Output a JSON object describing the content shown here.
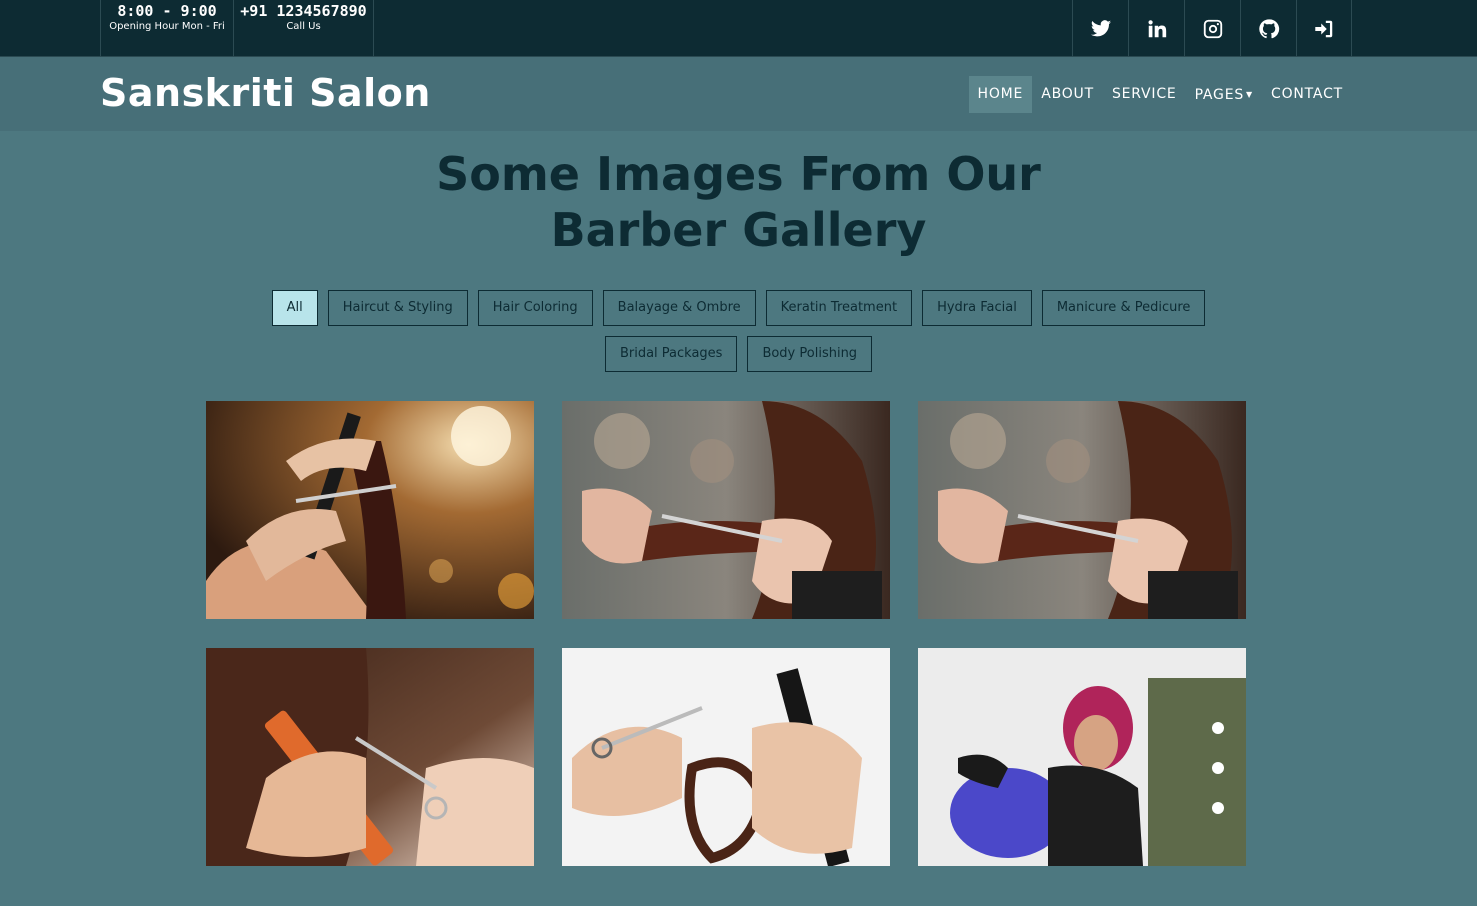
{
  "topbar": {
    "hours": "8:00 - 9:00",
    "hours_label": "Opening Hour Mon - Fri",
    "phone": "+91 1234567890",
    "phone_label": "Call Us",
    "social": [
      "twitter-icon",
      "linkedin-icon",
      "instagram-icon",
      "github-icon",
      "sign-in-icon"
    ]
  },
  "navbar": {
    "brand": "Sanskriti Salon",
    "items": [
      {
        "label": "HOME"
      },
      {
        "label": "ABOUT"
      },
      {
        "label": "SERVICE"
      },
      {
        "label": "PAGES"
      },
      {
        "label": "CONTACT"
      }
    ],
    "active": "HOME"
  },
  "gallery": {
    "title_line1": "Some Images From Our",
    "title_line2": "Barber Gallery",
    "filters_row1": [
      "All",
      "Haircut & Styling",
      "Hair Coloring",
      "Balayage & Ombre",
      "Keratin Treatment",
      "Hydra Facial",
      "Manicure & Pedicure"
    ],
    "filters_row2": [
      "Bridal Packages",
      "Body Polishing"
    ],
    "active_filter": "All",
    "images": [
      "haircut-comb-scissors",
      "hair-trim-salon",
      "hair-trim-salon",
      "comb-scissors-trim",
      "scissors-comb-closeup",
      "hair-coloring-stylist"
    ]
  },
  "colors": {
    "page_bg": "#4d7880",
    "topbar_bg": "#0d2b33",
    "navbar_bg": "#476f78",
    "active_filter_bg": "#b8e4ea",
    "heading_color": "#0d2b33"
  }
}
